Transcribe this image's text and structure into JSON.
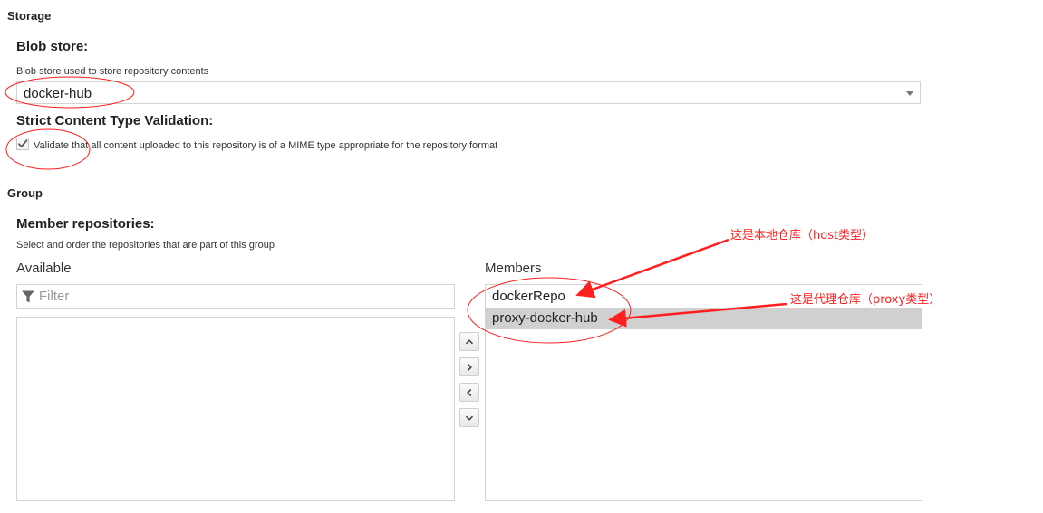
{
  "storage": {
    "title": "Storage",
    "blob_store": {
      "label": "Blob store:",
      "help": "Blob store used to store repository contents",
      "value": "docker-hub"
    },
    "strict_validation": {
      "label": "Strict Content Type Validation:",
      "checkbox_label": "Validate that all content uploaded to this repository is of a MIME type appropriate for the repository format",
      "checked": true
    }
  },
  "group": {
    "title": "Group",
    "member_repositories": {
      "label": "Member repositories:",
      "help": "Select and order the repositories that are part of this group",
      "available_title": "Available",
      "filter_placeholder": "Filter",
      "members_title": "Members",
      "members": [
        {
          "name": "dockerRepo",
          "selected": false
        },
        {
          "name": "proxy-docker-hub",
          "selected": true
        }
      ]
    }
  },
  "annotations": {
    "host_note": "这是本地仓库（host类型）",
    "proxy_note": "这是代理仓库（proxy类型）",
    "color": "#ff1f1f"
  },
  "icons": {
    "filter": "filter-icon",
    "dropdown": "chevron-down-icon",
    "move_up": "chevron-up-icon",
    "move_right": "chevron-right-icon",
    "move_left": "chevron-left-icon",
    "move_down": "chevron-down-icon",
    "check": "check-icon"
  }
}
